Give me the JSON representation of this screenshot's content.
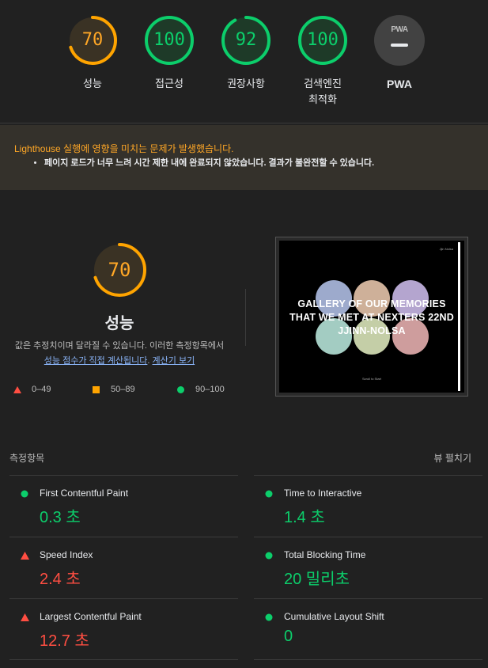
{
  "colors": {
    "pass": "#0cce6b",
    "average": "#ffa400",
    "fail": "#ff4e42",
    "link": "#8ab4f8"
  },
  "categories": [
    {
      "score": "70",
      "label": "성능",
      "fraction": 0.7,
      "status": "average"
    },
    {
      "score": "100",
      "label": "접근성",
      "fraction": 1.0,
      "status": "pass"
    },
    {
      "score": "92",
      "label": "권장사항",
      "fraction": 0.92,
      "status": "pass"
    },
    {
      "score": "100",
      "label": "검색엔진",
      "label2": "최적화",
      "fraction": 1.0,
      "status": "pass"
    }
  ],
  "pwa": {
    "badge_text": "PWA",
    "label": "PWA"
  },
  "warning": {
    "title": "Lighthouse 실행에 영향을 미치는 문제가 발생했습니다.",
    "items": [
      "페이지 로드가 너무 느려 시간 제한 내에 완료되지 않았습니다. 결과가 불완전할 수 있습니다."
    ]
  },
  "performance": {
    "score": "70",
    "fraction": 0.7,
    "title": "성능",
    "desc_line1": "값은 추정치이며 달라질 수 있습니다. 이러한 측정항목에서",
    "desc_link1": "성능 점수가 직접 계산됩니다",
    "desc_period": ". ",
    "desc_link2": "계산기 보기"
  },
  "legend": [
    {
      "icon": "fail-triangle-icon",
      "text": "0–49"
    },
    {
      "icon": "average-square-icon",
      "text": "50–89"
    },
    {
      "icon": "pass-circle-icon",
      "text": "90–100"
    }
  ],
  "screenshot": {
    "title_lines": [
      "GALLERY OF OUR MEMORIES",
      "THAT WE MET AT NEXTERS 22ND",
      "JJINN-NOLSA"
    ],
    "corner_text": "Jjin Nolsa",
    "footer_text": "Scroll to Start",
    "bubble_colors": [
      "#b9c8f0",
      "#f2cfb4",
      "#d3c2f3",
      "#bff0e4",
      "#e6f2c4",
      "#f2b8b8"
    ]
  },
  "metrics": {
    "header": "측정항목",
    "expand_label": "뷰 펼치기",
    "items": [
      {
        "name": "First Contentful Paint",
        "value": "0.3 초",
        "status": "pass"
      },
      {
        "name": "Time to Interactive",
        "value": "1.4 초",
        "status": "pass"
      },
      {
        "name": "Speed Index",
        "value": "2.4 초",
        "status": "fail"
      },
      {
        "name": "Total Blocking Time",
        "value": "20 밀리초",
        "status": "pass"
      },
      {
        "name": "Largest Contentful Paint",
        "value": "12.7 초",
        "status": "fail"
      },
      {
        "name": "Cumulative Layout Shift",
        "value": "0",
        "status": "pass"
      }
    ]
  }
}
